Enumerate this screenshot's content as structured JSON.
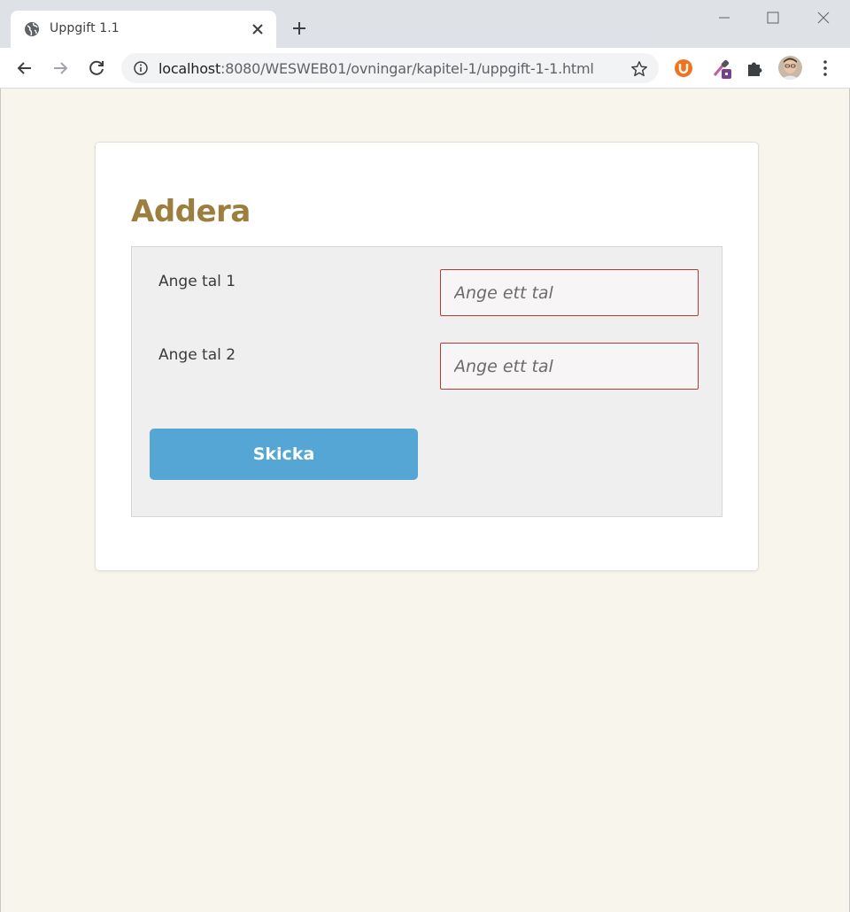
{
  "browser": {
    "tab_title": "Uppgift 1.1",
    "url_host": "localhost",
    "url_path": ":8080/WESWEB01/ovningar/kapitel-1/uppgift-1-1.html",
    "accent_color": "#dee1e6"
  },
  "page": {
    "heading": "Addera",
    "heading_color": "#9c7f3e",
    "fields": [
      {
        "label": "Ange tal 1",
        "placeholder": "Ange ett tal",
        "value": ""
      },
      {
        "label": "Ange tal 2",
        "placeholder": "Ange ett tal",
        "value": ""
      }
    ],
    "submit_label": "Skicka",
    "submit_color": "#56a6d5",
    "invalid_border_color": "#b93a32"
  }
}
